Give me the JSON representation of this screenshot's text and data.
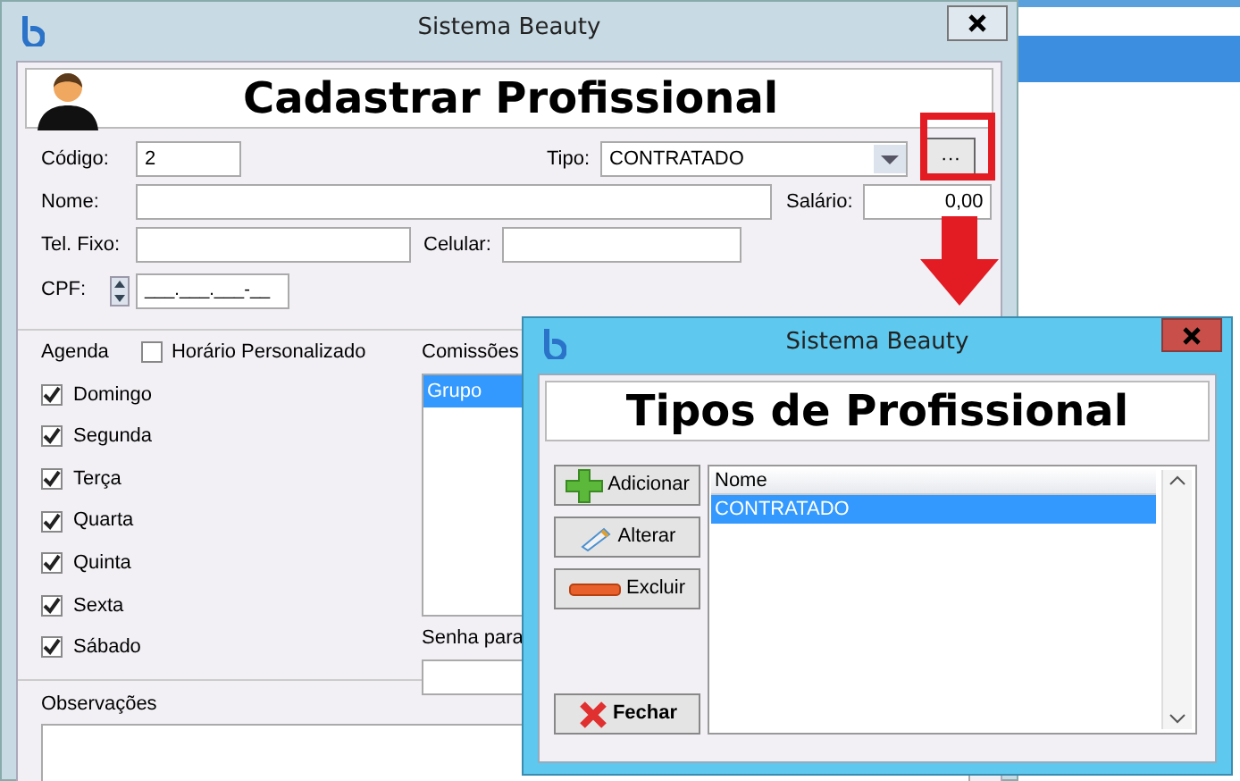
{
  "main_window": {
    "title": "Sistema Beauty",
    "heading": "Cadastrar Profissional",
    "codigo": {
      "label": "Código:",
      "value": "2"
    },
    "tipo": {
      "label": "Tipo:",
      "value": "CONTRATADO",
      "button_label": "···"
    },
    "nome": {
      "label": "Nome:"
    },
    "salario": {
      "label": "Salário:",
      "value": "0,00"
    },
    "tel_fixo": {
      "label": "Tel. Fixo:"
    },
    "celular": {
      "label": "Celular:"
    },
    "cpf": {
      "label": "CPF:",
      "value": "___.___.___-__"
    },
    "agenda": {
      "label": "Agenda",
      "custom_hours": {
        "label": "Horário Personalizado",
        "checked": false
      },
      "days": [
        {
          "label": "Domingo",
          "checked": true
        },
        {
          "label": "Segunda",
          "checked": true
        },
        {
          "label": "Terça",
          "checked": true
        },
        {
          "label": "Quarta",
          "checked": true
        },
        {
          "label": "Quinta",
          "checked": true
        },
        {
          "label": "Sexta",
          "checked": true
        },
        {
          "label": "Sábado",
          "checked": true
        }
      ]
    },
    "commissions": {
      "label": "Comissões",
      "items": [
        {
          "label": "Grupo",
          "selected": true
        }
      ]
    },
    "password": {
      "label": "Senha para"
    },
    "notes": {
      "label": "Observações"
    }
  },
  "dialog": {
    "title": "Sistema Beauty",
    "heading": "Tipos de Profissional",
    "buttons": [
      {
        "label": "Adicionar",
        "kind": "add"
      },
      {
        "label": "Alterar",
        "kind": "edit"
      },
      {
        "label": "Excluir",
        "kind": "delete"
      },
      {
        "label": "Fechar",
        "kind": "close"
      }
    ],
    "grid": {
      "columns": [
        "Nome"
      ],
      "rows": [
        {
          "cells": [
            "CONTRATADO"
          ],
          "selected": true
        }
      ]
    }
  }
}
